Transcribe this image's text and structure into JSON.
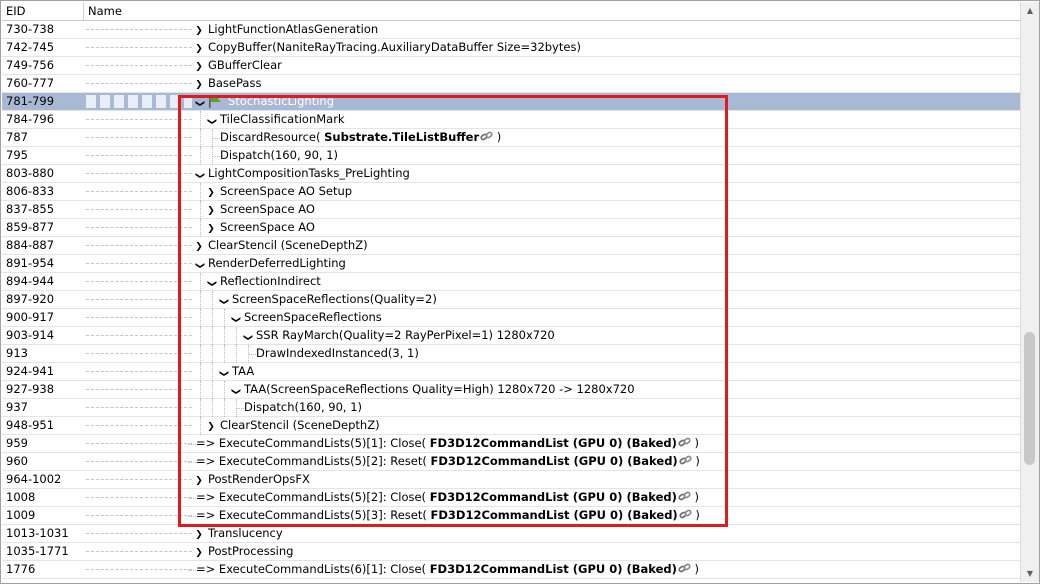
{
  "columns": {
    "eid": "EID",
    "name": "Name"
  },
  "rows": [
    {
      "eid": "730-738",
      "depth": 0,
      "tw": "exp",
      "parts": [
        {
          "t": "LightFunctionAtlasGeneration"
        }
      ]
    },
    {
      "eid": "742-745",
      "depth": 0,
      "tw": "exp",
      "parts": [
        {
          "t": "CopyBuffer(NaniteRayTracing.AuxiliaryDataBuffer Size=32bytes)"
        }
      ]
    },
    {
      "eid": "749-756",
      "depth": 0,
      "tw": "exp",
      "parts": [
        {
          "t": "GBufferClear"
        }
      ]
    },
    {
      "eid": "760-777",
      "depth": 0,
      "tw": "exp",
      "parts": [
        {
          "t": "BasePass"
        }
      ]
    },
    {
      "eid": "781-799",
      "depth": 0,
      "tw": "col",
      "flag": true,
      "selected": true,
      "parts": [
        {
          "t": "StochasticLighting"
        }
      ]
    },
    {
      "eid": "784-796",
      "depth": 1,
      "tw": "col",
      "parts": [
        {
          "t": "TileClassificationMark"
        }
      ]
    },
    {
      "eid": "787",
      "depth": 2,
      "tw": "none",
      "parts": [
        {
          "t": "DiscardResource( "
        },
        {
          "t": "Substrate.TileListBuffer",
          "b": true
        },
        {
          "link": true
        },
        {
          "t": " )"
        }
      ]
    },
    {
      "eid": "795",
      "depth": 2,
      "tw": "none",
      "parts": [
        {
          "t": "Dispatch(160, 90, 1)"
        }
      ]
    },
    {
      "eid": "803-880",
      "depth": 0,
      "tw": "col",
      "parts": [
        {
          "t": "LightCompositionTasks_PreLighting"
        }
      ]
    },
    {
      "eid": "806-833",
      "depth": 1,
      "tw": "exp",
      "parts": [
        {
          "t": "ScreenSpace AO Setup"
        }
      ]
    },
    {
      "eid": "837-855",
      "depth": 1,
      "tw": "exp",
      "parts": [
        {
          "t": "ScreenSpace AO"
        }
      ]
    },
    {
      "eid": "859-877",
      "depth": 1,
      "tw": "exp",
      "parts": [
        {
          "t": "ScreenSpace AO"
        }
      ]
    },
    {
      "eid": "884-887",
      "depth": 0,
      "tw": "exp",
      "parts": [
        {
          "t": "ClearStencil (SceneDepthZ)"
        }
      ]
    },
    {
      "eid": "891-954",
      "depth": 0,
      "tw": "col",
      "parts": [
        {
          "t": "RenderDeferredLighting"
        }
      ]
    },
    {
      "eid": "894-944",
      "depth": 1,
      "tw": "col",
      "parts": [
        {
          "t": "ReflectionIndirect"
        }
      ]
    },
    {
      "eid": "897-920",
      "depth": 2,
      "tw": "col",
      "parts": [
        {
          "t": "ScreenSpaceReflections(Quality=2)"
        }
      ]
    },
    {
      "eid": "900-917",
      "depth": 3,
      "tw": "col",
      "parts": [
        {
          "t": "ScreenSpaceReflections"
        }
      ]
    },
    {
      "eid": "903-914",
      "depth": 4,
      "tw": "col",
      "parts": [
        {
          "t": "SSR RayMarch(Quality=2 RayPerPixel=1) 1280x720"
        }
      ]
    },
    {
      "eid": "913",
      "depth": 5,
      "tw": "none",
      "parts": [
        {
          "t": "DrawIndexedInstanced(3, 1)"
        }
      ]
    },
    {
      "eid": "924-941",
      "depth": 2,
      "tw": "col",
      "parts": [
        {
          "t": "TAA"
        }
      ]
    },
    {
      "eid": "927-938",
      "depth": 3,
      "tw": "col",
      "parts": [
        {
          "t": "TAA(ScreenSpaceReflections Quality=High) 1280x720 -> 1280x720"
        }
      ]
    },
    {
      "eid": "937",
      "depth": 4,
      "tw": "none",
      "parts": [
        {
          "t": "Dispatch(160, 90, 1)"
        }
      ]
    },
    {
      "eid": "948-951",
      "depth": 1,
      "tw": "exp",
      "parts": [
        {
          "t": "ClearStencil (SceneDepthZ)"
        }
      ]
    },
    {
      "eid": "959",
      "depth": 0,
      "tw": "none",
      "parts": [
        {
          "t": "=>  ExecuteCommandLists(5)[1]: Close( "
        },
        {
          "t": "FD3D12CommandList (GPU 0) (Baked)",
          "b": true
        },
        {
          "link": true
        },
        {
          "t": " )"
        }
      ]
    },
    {
      "eid": "960",
      "depth": 0,
      "tw": "none",
      "parts": [
        {
          "t": "=>  ExecuteCommandLists(5)[2]: Reset( "
        },
        {
          "t": "FD3D12CommandList (GPU 0) (Baked)",
          "b": true
        },
        {
          "link": true
        },
        {
          "t": " )"
        }
      ]
    },
    {
      "eid": "964-1002",
      "depth": 0,
      "tw": "exp",
      "parts": [
        {
          "t": "PostRenderOpsFX"
        }
      ]
    },
    {
      "eid": "1008",
      "depth": 0,
      "tw": "none",
      "parts": [
        {
          "t": "=>  ExecuteCommandLists(5)[2]: Close( "
        },
        {
          "t": "FD3D12CommandList (GPU 0) (Baked)",
          "b": true
        },
        {
          "link": true
        },
        {
          "t": " )"
        }
      ]
    },
    {
      "eid": "1009",
      "depth": 0,
      "tw": "none",
      "parts": [
        {
          "t": "=>  ExecuteCommandLists(5)[3]: Reset( "
        },
        {
          "t": "FD3D12CommandList (GPU 0) (Baked)",
          "b": true
        },
        {
          "link": true
        },
        {
          "t": " )"
        }
      ]
    },
    {
      "eid": "1013-1031",
      "depth": 0,
      "tw": "exp",
      "parts": [
        {
          "t": "Translucency"
        }
      ]
    },
    {
      "eid": "1035-1771",
      "depth": 0,
      "tw": "exp",
      "parts": [
        {
          "t": "PostProcessing"
        }
      ]
    },
    {
      "eid": "1776",
      "depth": 0,
      "tw": "none",
      "parts": [
        {
          "t": "=>  ExecuteCommandLists(6)[1]: Close( "
        },
        {
          "t": "FD3D12CommandList (GPU 0) (Baked)",
          "b": true
        },
        {
          "link": true
        },
        {
          "t": " )"
        }
      ]
    }
  ],
  "icons": {
    "expand": "chevron-right-icon",
    "collapse": "chevron-down-icon",
    "marker": "flag-icon",
    "resource_link": "link-icon"
  },
  "colors": {
    "selection": "#a7b9d4",
    "highlight_box": "#e01b1b",
    "flag": "#5aa22e"
  }
}
